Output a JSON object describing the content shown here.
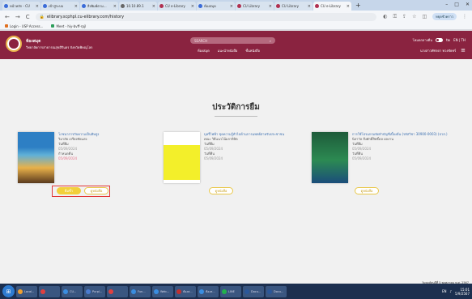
{
  "browser": {
    "tabs": [
      {
        "label": "หน้าหลัก - CU",
        "color": "#3a6bd8",
        "active": false
      },
      {
        "label": "เข้าสู่ระบบ",
        "color": "#3a6bd8",
        "active": false
      },
      {
        "label": "สิ่งพิมพ์ตาม...",
        "color": "#3a6bd8",
        "active": false
      },
      {
        "label": "10.10.89.1",
        "color": "#666",
        "active": false
      },
      {
        "label": "CU e-Library",
        "color": "#b03050",
        "active": false
      },
      {
        "label": "ห้องสมุด",
        "color": "#3a6bd8",
        "active": false
      },
      {
        "label": "CU Library",
        "color": "#b03050",
        "active": false
      },
      {
        "label": "CU Library",
        "color": "#b03050",
        "active": false
      },
      {
        "label": "CU e-Library",
        "color": "#b03050",
        "active": true
      }
    ],
    "new_tab": "+",
    "url": "elibrary.scphpl.cu-elibrary.com/history",
    "profile_label": "หยุดชั่วคราว",
    "bookmarks": [
      {
        "label": "Login - USP Access...",
        "color": "#e07020"
      },
      {
        "label": "Meet - hiy-bvff-rpjl",
        "color": "#2e9e5b"
      }
    ]
  },
  "header": {
    "library_name": "ห้องสมุด",
    "library_sub": "วิทยาลัยการสาธารณสุขสิรินธร จังหวัดพิษณุโลก",
    "search_placeholder": "SEARCH",
    "nav": [
      "ห้องสมุด",
      "แนะนำหนังสือ",
      "ชั้นหนังสือ"
    ],
    "nav_right_label": "โหมดกลางคืน",
    "toggle_label": "ปิด",
    "lang": "EN | TH",
    "user_name": "นางสาวพัชรดา พวงชัยทร์"
  },
  "page": {
    "title": "ประวัติการยืม",
    "books": [
      {
        "title": "โภชนาการกับความเป็นพิษสูง",
        "author": "วิมาลัย เกรียงชัยแสง",
        "borrow_label": "วันที่ยืม",
        "borrow_date": "05/09/2024",
        "return_label": "กำหนดคืน",
        "return_date": "05/09/2024",
        "btn_primary": "ยืมซ้ำ",
        "btn_secondary": "ดูหนังสือ"
      },
      {
        "title": "บุหรี่ไฟฟ้า ชุดความรู้ทั่วไปด้านการแพทย์สาหรับประชาชน",
        "author": "คณะ วิธีแนวโน้มกายิลิต",
        "borrow_label": "วันที่ยืม",
        "borrow_date": "05/09/2024",
        "return_label": "วันที่คืน",
        "return_date": "05/09/2024",
        "btn_secondary": "ดูหนังสือ"
      },
      {
        "title": "การใช้โปรแกรมจัดทำบัญชีเบื้องต้น (รหัสวิชา 30900-0003) (ปวส.)",
        "author": "นิลาวัล สิ่งศักดิ์สิทธิ์ดล ผลงาน",
        "borrow_label": "วันที่ยืม",
        "borrow_date": "05/09/2024",
        "return_label": "วันที่คืน",
        "return_date": "05/09/2024",
        "btn_secondary": "ดูหนังสือ"
      }
    ]
  },
  "taskbar": {
    "items": [
      {
        "label": "Local...",
        "color": "#f0a030"
      },
      {
        "label": "",
        "color": "#e04040"
      },
      {
        "label": "CU...",
        "color": "#3a8de0"
      },
      {
        "label": "Purpl...",
        "color": "#4a7bd0"
      },
      {
        "label": "",
        "color": "#e04040"
      },
      {
        "label": "Fun...",
        "color": "#3a8de0"
      },
      {
        "label": "Web...",
        "color": "#3a8de0"
      },
      {
        "label": "ห้องส...",
        "color": "#c03030"
      },
      {
        "label": "ห้องส...",
        "color": "#3a8de0"
      },
      {
        "label": "LINE",
        "color": "#22b14c"
      },
      {
        "label": "Docu...",
        "color": "#2b579a"
      },
      {
        "label": "Docu...",
        "color": "#2b579a"
      }
    ],
    "lang": "EN",
    "time": "15:01",
    "date": "5/9/2567",
    "notification": "วันพฤหัสบดีที่ 5 พฤศภาคม พ.ศ. 2567"
  }
}
